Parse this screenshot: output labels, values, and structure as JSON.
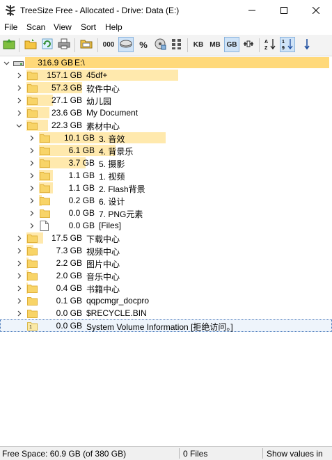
{
  "window": {
    "title": "TreeSize Free - Allocated - Drive: Data (E:)"
  },
  "menu": [
    "File",
    "Scan",
    "View",
    "Sort",
    "Help"
  ],
  "toolbar": {
    "unit_kb": "KB",
    "unit_mb": "MB",
    "unit_gb": "GB",
    "count_label": "000",
    "percent_label": "%",
    "active_unit": "GB"
  },
  "tree": {
    "root": {
      "size": "316.9 GB",
      "name": "E:\\",
      "fraction": 1.0
    },
    "rows": [
      {
        "size": "157.1 GB",
        "name": "45df+",
        "fraction": 0.496,
        "level": 1,
        "expander": "collapsed",
        "icon": "folder"
      },
      {
        "size": "57.3 GB",
        "name": "软件中心",
        "fraction": 0.181,
        "level": 1,
        "expander": "collapsed",
        "icon": "folder"
      },
      {
        "size": "27.1 GB",
        "name": "幼儿园",
        "fraction": 0.086,
        "level": 1,
        "expander": "collapsed",
        "icon": "folder"
      },
      {
        "size": "23.6 GB",
        "name": "My Document",
        "fraction": 0.074,
        "level": 1,
        "expander": "collapsed",
        "icon": "folder"
      },
      {
        "size": "22.3 GB",
        "name": "素材中心",
        "fraction": 0.07,
        "level": 1,
        "expander": "expanded",
        "icon": "folder"
      },
      {
        "size": "10.1 GB",
        "name": "3. 音效",
        "fraction": 0.453,
        "level": 2,
        "expander": "collapsed",
        "icon": "folder"
      },
      {
        "size": "6.1 GB",
        "name": "4. 背景乐",
        "fraction": 0.274,
        "level": 2,
        "expander": "collapsed",
        "icon": "folder"
      },
      {
        "size": "3.7 GB",
        "name": "5. 摄影",
        "fraction": 0.166,
        "level": 2,
        "expander": "collapsed",
        "icon": "folder"
      },
      {
        "size": "1.1 GB",
        "name": "1. 视频",
        "fraction": 0.049,
        "level": 2,
        "expander": "collapsed",
        "icon": "folder"
      },
      {
        "size": "1.1 GB",
        "name": "2. Flash背景",
        "fraction": 0.049,
        "level": 2,
        "expander": "collapsed",
        "icon": "folder"
      },
      {
        "size": "0.2 GB",
        "name": "6. 设计",
        "fraction": 0.009,
        "level": 2,
        "expander": "collapsed",
        "icon": "folder"
      },
      {
        "size": "0.0 GB",
        "name": "7. PNG元素",
        "fraction": 0.0,
        "level": 2,
        "expander": "collapsed",
        "icon": "folder"
      },
      {
        "size": "0.0 GB",
        "name": "[Files]",
        "fraction": 0.0,
        "level": 2,
        "expander": "collapsed",
        "icon": "file"
      },
      {
        "size": "17.5 GB",
        "name": "下载中心",
        "fraction": 0.055,
        "level": 1,
        "expander": "collapsed",
        "icon": "folder"
      },
      {
        "size": "7.3 GB",
        "name": "视频中心",
        "fraction": 0.023,
        "level": 1,
        "expander": "collapsed",
        "icon": "folder"
      },
      {
        "size": "2.2 GB",
        "name": "图片中心",
        "fraction": 0.007,
        "level": 1,
        "expander": "collapsed",
        "icon": "folder"
      },
      {
        "size": "2.0 GB",
        "name": "音乐中心",
        "fraction": 0.006,
        "level": 1,
        "expander": "collapsed",
        "icon": "folder"
      },
      {
        "size": "0.4 GB",
        "name": "书籍中心",
        "fraction": 0.001,
        "level": 1,
        "expander": "collapsed",
        "icon": "folder"
      },
      {
        "size": "0.1 GB",
        "name": "qqpcmgr_docpro",
        "fraction": 0.0,
        "level": 1,
        "expander": "collapsed",
        "icon": "folder"
      },
      {
        "size": "0.0 GB",
        "name": "$RECYCLE.BIN",
        "fraction": 0.0,
        "level": 1,
        "expander": "collapsed",
        "icon": "folder"
      },
      {
        "size": "0.0 GB",
        "name": "System Volume Information  [拒绝访问。]",
        "fraction": 0.0,
        "level": 1,
        "expander": "none",
        "icon": "folder-denied",
        "selected": true
      }
    ]
  },
  "status": {
    "free_space": "Free Space: 60.9 GB  (of 380 GB)",
    "files": "0  Files",
    "show_values": "Show values in"
  }
}
